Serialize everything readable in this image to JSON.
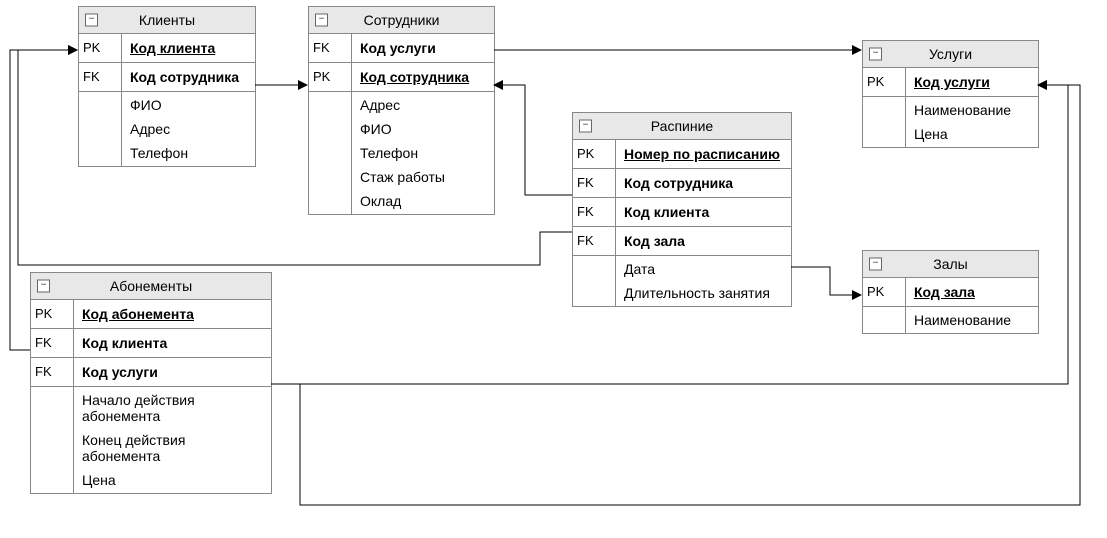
{
  "entities": {
    "clients": {
      "title": "Клиенты",
      "rows": [
        {
          "key": "PK",
          "field": "Код клиента",
          "cls": "pk"
        },
        {
          "key": "FK",
          "field": "Код сотрудника",
          "cls": "fk"
        }
      ],
      "attrs": [
        "ФИО",
        "Адрес",
        "Телефон"
      ]
    },
    "employees": {
      "title": "Сотрудники",
      "rows": [
        {
          "key": "FK",
          "field": "Код услуги",
          "cls": "fk"
        },
        {
          "key": "PK",
          "field": "Код сотрудника",
          "cls": "pk"
        }
      ],
      "attrs": [
        "Адрес",
        "ФИО",
        "Телефон",
        "Стаж работы",
        "Оклад"
      ]
    },
    "services": {
      "title": "Услуги",
      "rows": [
        {
          "key": "PK",
          "field": "Код услуги",
          "cls": "pk"
        }
      ],
      "attrs": [
        "Наименование",
        "Цена"
      ]
    },
    "schedule": {
      "title": "Распиние",
      "rows": [
        {
          "key": "PK",
          "field": "Номер по расписанию",
          "cls": "pk"
        },
        {
          "key": "FK",
          "field": "Код сотрудника",
          "cls": "fk"
        },
        {
          "key": "FK",
          "field": "Код клиента",
          "cls": "fk"
        },
        {
          "key": "FK",
          "field": "Код зала",
          "cls": "fk"
        }
      ],
      "attrs": [
        "Дата",
        "Длительность занятия"
      ]
    },
    "halls": {
      "title": "Залы",
      "rows": [
        {
          "key": "PK",
          "field": "Код зала",
          "cls": "pk"
        }
      ],
      "attrs": [
        "Наименование"
      ]
    },
    "subs": {
      "title": "Абонементы",
      "rows": [
        {
          "key": "PK",
          "field": "Код абонемента",
          "cls": "pk"
        },
        {
          "key": "FK",
          "field": "Код клиента",
          "cls": "fk"
        },
        {
          "key": "FK",
          "field": "Код услуги",
          "cls": "fk"
        }
      ],
      "attrs": [
        "Начало действия абонемента",
        "Конец действия абонемента",
        "Цена"
      ]
    }
  }
}
